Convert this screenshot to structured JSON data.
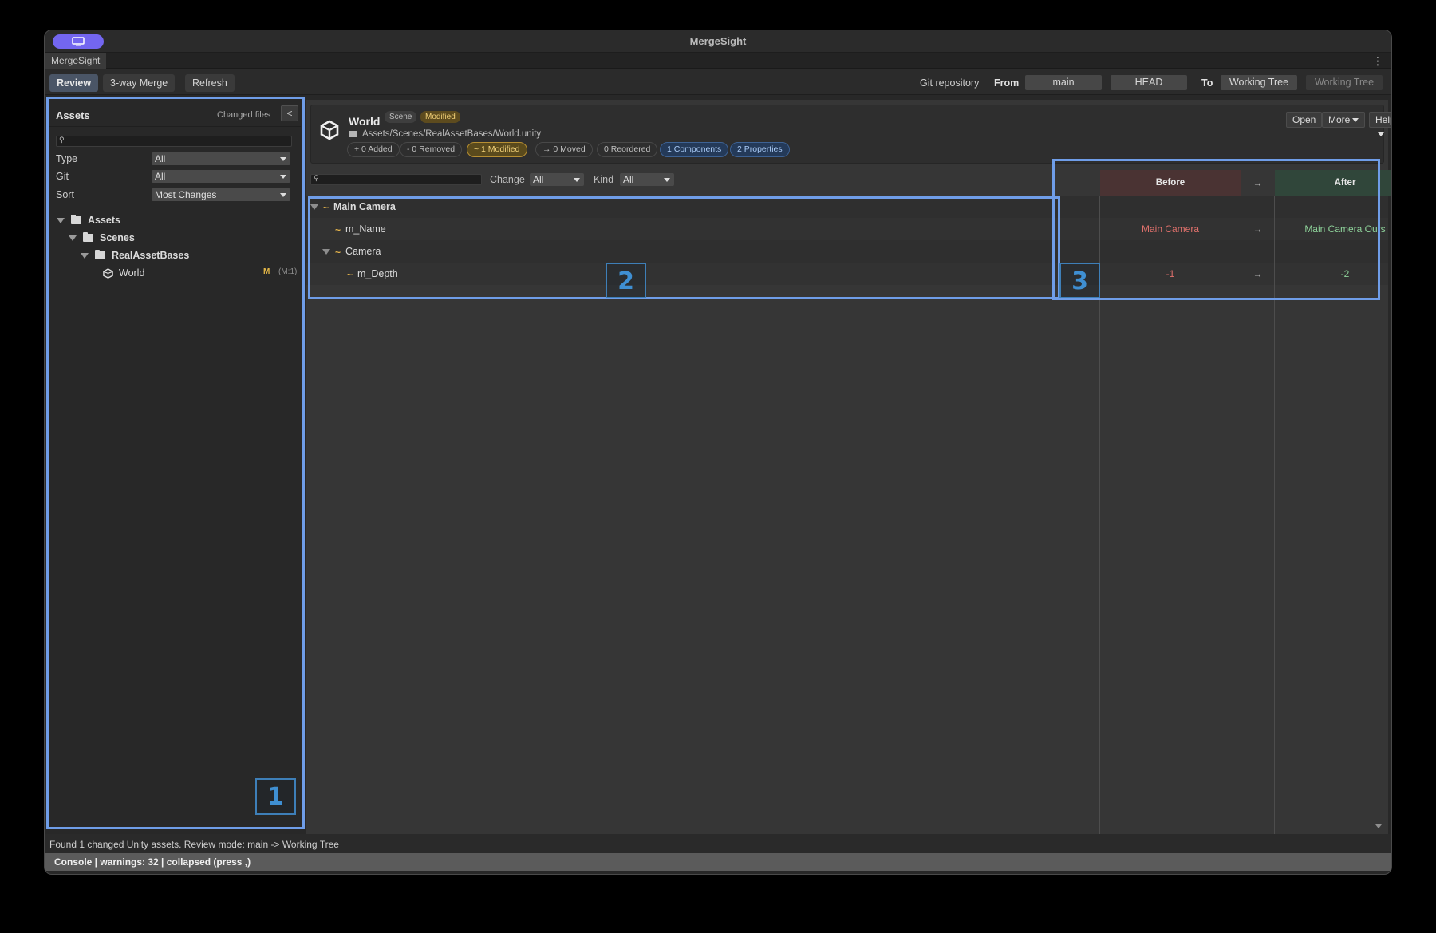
{
  "window": {
    "title": "MergeSight",
    "tab": "MergeSight"
  },
  "toolbar": {
    "review": "Review",
    "three_way": "3-way Merge",
    "refresh": "Refresh",
    "git_repository": "Git repository",
    "from_label": "From",
    "from_branch": "main",
    "from_ref": "HEAD",
    "to_label": "To",
    "to_target": "Working Tree",
    "to_ref": "Working Tree"
  },
  "sidebar": {
    "title": "Assets",
    "changed_files": "Changed files",
    "collapse": "<",
    "filters": [
      {
        "label": "Type",
        "value": "All"
      },
      {
        "label": "Git",
        "value": "All"
      },
      {
        "label": "Sort",
        "value": "Most Changes"
      }
    ],
    "tree": [
      {
        "label": "Assets"
      },
      {
        "label": "Scenes"
      },
      {
        "label": "RealAssetBases"
      },
      {
        "label": "World",
        "badge": "M",
        "count": "(M:1)"
      }
    ]
  },
  "asset": {
    "name": "World",
    "type_tag": "Scene",
    "status_tag": "Modified",
    "path": "Assets/Scenes/RealAssetBases/World.unity",
    "chips": {
      "added": "+ 0 Added",
      "removed": "- 0 Removed",
      "modified": "~ 1 Modified",
      "moved": "→ 0 Moved",
      "reordered": "0 Reordered",
      "components": "1 Components",
      "properties": "2 Properties"
    },
    "buttons": {
      "open": "Open",
      "more": "More",
      "help": "Help"
    }
  },
  "diff": {
    "change_label": "Change",
    "change_value": "All",
    "kind_label": "Kind",
    "kind_value": "All",
    "col_before": "Before",
    "col_arrow": "→",
    "col_after": "After",
    "rows": [
      {
        "marker": "~",
        "name": "Main Camera"
      },
      {
        "marker": "~",
        "name": "m_Name",
        "before": "Main Camera",
        "arrow": "→",
        "after": "Main Camera Ours"
      },
      {
        "marker": "~",
        "name": "Camera"
      },
      {
        "marker": "~",
        "name": "m_Depth",
        "before": "-1",
        "arrow": "→",
        "after": "-2"
      }
    ]
  },
  "status": {
    "message": "Found 1 changed Unity assets. Review mode: main -> Working Tree",
    "console": "Console | warnings: 32 | collapsed (press ,)"
  },
  "annotations": {
    "one": "1",
    "two": "2",
    "three": "3"
  },
  "colors": {
    "accent": "#7366f0",
    "annotation_box": "#6f9de8",
    "before_bg": "#4a3333",
    "after_bg": "#30463a",
    "modified": "#e8b64c"
  }
}
